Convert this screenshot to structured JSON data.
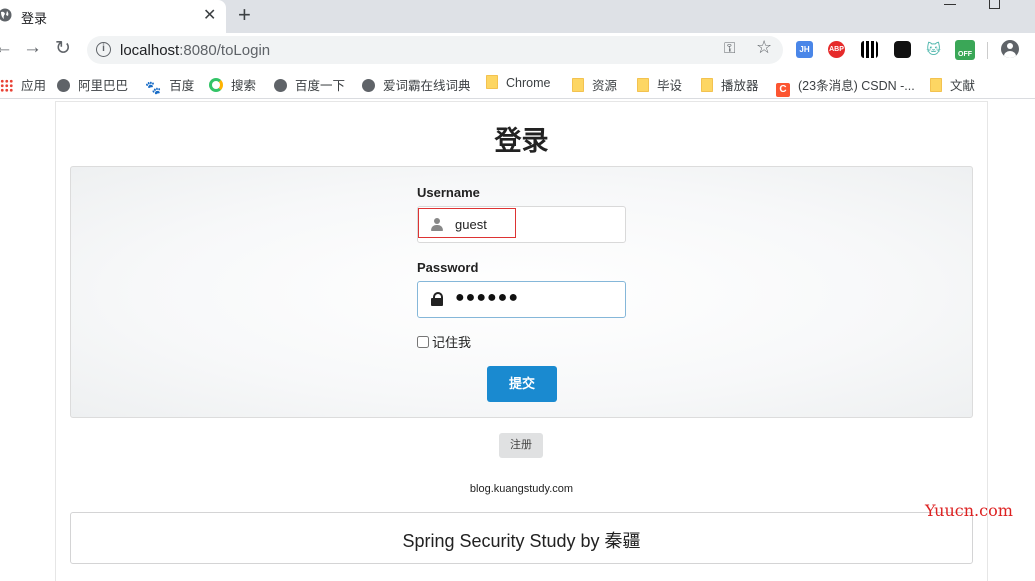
{
  "browser": {
    "tab_title": "登录",
    "tab_close": "✕",
    "new_tab": "+",
    "url_host": "localhost",
    "url_rest": ":8080/toLogin",
    "extensions": {
      "jh": "JH",
      "abp": "ABP",
      "off": "OFF"
    },
    "bookmarks": [
      {
        "label": "应用",
        "icon": "apps-icon"
      },
      {
        "label": "阿里巴巴",
        "icon": "globe-icon"
      },
      {
        "label": "百度",
        "icon": "baidu-paw-icon"
      },
      {
        "label": "搜索",
        "icon": "search-engine-icon"
      },
      {
        "label": "百度一下",
        "icon": "globe-icon"
      },
      {
        "label": "爱词霸在线词典",
        "icon": "globe-icon"
      },
      {
        "label": "Chrome",
        "icon": "folder-icon"
      },
      {
        "label": "资源",
        "icon": "folder-icon"
      },
      {
        "label": "毕设",
        "icon": "folder-icon"
      },
      {
        "label": "播放器",
        "icon": "folder-icon"
      },
      {
        "label": "(23条消息) CSDN -...",
        "icon": "csdn-icon"
      },
      {
        "label": "文献",
        "icon": "folder-icon"
      }
    ]
  },
  "page": {
    "title": "登录",
    "form": {
      "username_label": "Username",
      "username_value": "guest",
      "password_label": "Password",
      "password_value": "●●●●●●",
      "remember_label": "记住我",
      "remember_checked": false,
      "submit_label": "提交"
    },
    "register_label": "注册",
    "blog_link": "blog.kuangstudy.com",
    "footer_text": "Spring Security Study by 秦疆"
  },
  "watermark": "Yuucn.com",
  "colors": {
    "primary_button": "#1a8ad0",
    "highlight_border": "#dd3333",
    "watermark": "#dd2222"
  }
}
